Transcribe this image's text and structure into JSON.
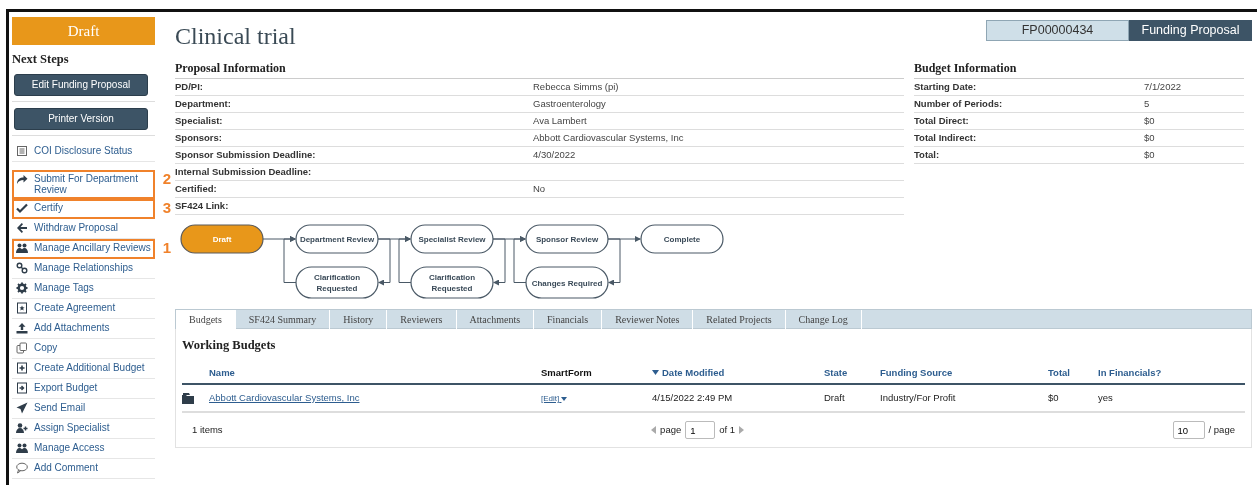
{
  "status_badge": "Draft",
  "next_steps": {
    "title": "Next Steps",
    "buttons": [
      "Edit Funding Proposal",
      "Printer Version"
    ]
  },
  "actions": [
    {
      "label": "COI Disclosure Status"
    },
    {
      "label": "Submit For Department Review",
      "callout": "2"
    },
    {
      "label": "Certify",
      "callout": "3"
    },
    {
      "label": "Withdraw Proposal"
    },
    {
      "label": "Manage Ancillary Reviews",
      "callout": "1"
    },
    {
      "label": "Manage Relationships"
    },
    {
      "label": "Manage Tags"
    },
    {
      "label": "Create Agreement"
    },
    {
      "label": "Add Attachments"
    },
    {
      "label": "Copy"
    },
    {
      "label": "Create Additional Budget"
    },
    {
      "label": "Export Budget"
    },
    {
      "label": "Send Email"
    },
    {
      "label": "Assign Specialist"
    },
    {
      "label": "Manage Access"
    },
    {
      "label": "Add Comment"
    }
  ],
  "title": "Clinical trial",
  "record": {
    "id": "FP00000434",
    "type": "Funding Proposal"
  },
  "proposal_info": {
    "title": "Proposal Information",
    "fields": [
      {
        "label": "PD/PI:",
        "value": "Rebecca Simms (pi)"
      },
      {
        "label": "Department:",
        "value": "Gastroenterology"
      },
      {
        "label": "Specialist:",
        "value": "Ava Lambert"
      },
      {
        "label": "Sponsors:",
        "value": "Abbott Cardiovascular Systems, Inc"
      },
      {
        "label": "Sponsor Submission Deadline:",
        "value": "4/30/2022"
      },
      {
        "label": "Internal Submission Deadline:"
      },
      {
        "label": "Certified:",
        "value": "No"
      },
      {
        "label": "SF424 Link:"
      }
    ]
  },
  "budget_info": {
    "title": "Budget Information",
    "fields": [
      {
        "label": "Starting Date:",
        "value": "7/1/2022"
      },
      {
        "label": "Number of Periods:",
        "value": "5"
      },
      {
        "label": "Total Direct:",
        "value": "$0"
      },
      {
        "label": "Total Indirect:",
        "value": "$0"
      },
      {
        "label": "Total:",
        "value": "$0"
      }
    ]
  },
  "workflow": {
    "steps": [
      {
        "label": "Draft",
        "current": true
      },
      {
        "label": "Department Review",
        "current": false,
        "return_step": "Clarification Requested"
      },
      {
        "label": "Specialist Review",
        "current": false,
        "return_step": "Clarification Requested"
      },
      {
        "label": "Sponsor Review",
        "current": false,
        "return_step": "Changes Required"
      },
      {
        "label": "Complete",
        "current": false
      }
    ]
  },
  "tabs": [
    {
      "label": "Budgets",
      "selected": true
    },
    {
      "label": "SF424 Summary",
      "selected": false
    },
    {
      "label": "History",
      "selected": false
    },
    {
      "label": "Reviewers",
      "selected": false
    },
    {
      "label": "Attachments",
      "selected": false
    },
    {
      "label": "Financials",
      "selected": false
    },
    {
      "label": "Reviewer Notes",
      "selected": false
    },
    {
      "label": "Related Projects",
      "selected": false
    },
    {
      "label": "Change Log",
      "selected": false
    }
  ],
  "working_budgets": {
    "title": "Working Budgets",
    "columns": [
      {
        "label": "Name",
        "sortable": true,
        "sorted": false
      },
      {
        "label": "SmartForm",
        "sortable": false,
        "sorted": false
      },
      {
        "label": "Date Modified",
        "sortable": true,
        "sorted": true
      },
      {
        "label": "State",
        "sortable": true,
        "sorted": false
      },
      {
        "label": "Funding Source",
        "sortable": true,
        "sorted": false
      },
      {
        "label": "Total",
        "sortable": true,
        "sorted": false
      },
      {
        "label": "In Financials?",
        "sortable": true,
        "sorted": false
      }
    ],
    "rows": [
      {
        "name": "Abbott Cardiovascular Systems, Inc",
        "smartform": "[Edit]",
        "date_modified": "4/15/2022 2:49 PM",
        "state": "Draft",
        "funding_source": "Industry/For Profit",
        "total": "$0",
        "in_financials": "yes"
      }
    ],
    "footer": {
      "count": "1 items",
      "page_label": "page",
      "page": "1",
      "of": "of 1",
      "page_size": "10",
      "per_page": "/ page"
    }
  }
}
